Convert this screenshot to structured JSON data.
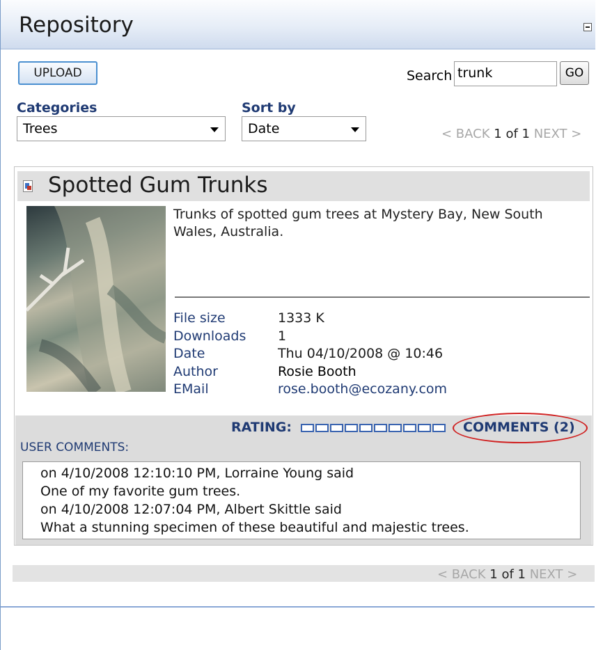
{
  "panel": {
    "title": "Repository"
  },
  "toolbar": {
    "upload_label": "UPLOAD",
    "search_label": "Search",
    "search_value": "trunk",
    "go_label": "GO"
  },
  "filters": {
    "categories_label": "Categories",
    "categories_value": "Trees",
    "sortby_label": "Sort by",
    "sortby_value": "Date"
  },
  "pager_top": {
    "back": "< BACK",
    "current": "1 of 1",
    "next": "NEXT >"
  },
  "item": {
    "title": "Spotted Gum Trunks",
    "description": "Trunks of spotted gum trees at Mystery Bay, New South Wales, Australia.",
    "details": [
      {
        "key": "File size",
        "value": "1333 K"
      },
      {
        "key": "Downloads",
        "value": "1"
      },
      {
        "key": "Date",
        "value": "Thu 04/10/2008 @ 10:46"
      },
      {
        "key": "Author",
        "value": "Rosie Booth"
      },
      {
        "key": "EMail",
        "value": "rose.booth@ecozany.com"
      }
    ],
    "rating_label": "RATING:",
    "rating_value": 0,
    "rating_max": 10,
    "comments_link": "COMMENTS (2)",
    "user_comments_label": "USER COMMENTS:",
    "comments": [
      "on 4/10/2008 12:10:10 PM, Lorraine Young said",
      "One of my favorite gum trees.",
      "on 4/10/2008 12:07:04 PM, Albert Skittle said",
      "What a stunning specimen of these beautiful and majestic trees."
    ]
  },
  "pager_bottom": {
    "back": "< BACK",
    "current": "1 of 1",
    "next": "NEXT >"
  },
  "colors": {
    "link_navy": "#1f3a73",
    "highlight_circle": "#d02020",
    "rating_box": "#3a64b0"
  }
}
